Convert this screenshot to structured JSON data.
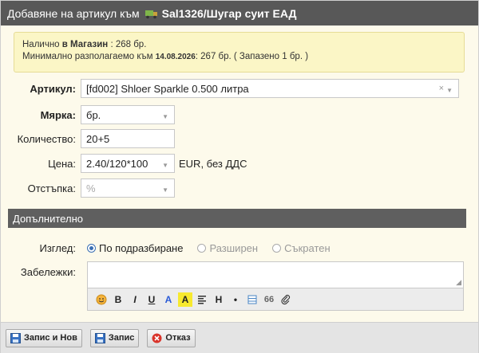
{
  "title": {
    "prefix": "Добавяне на артикул към",
    "object": "Sal1326/Шугар суит ЕАД"
  },
  "notice": {
    "line1_prefix": "Налично",
    "line1_bold": "в Магазин",
    "line1_suffix": ": 268 бр.",
    "line2_prefix": "Минимално разполагаемо към",
    "line2_date": "14.08.2026",
    "line2_suffix": ": 267 бр. ( Запазено 1 бр. )"
  },
  "form": {
    "article_label": "Артикул",
    "article_value": "[fd002] Shloer Sparkle 0.500 литра",
    "measure_label": "Мярка",
    "measure_value": "бр.",
    "quantity_label": "Количество:",
    "quantity_value": "20+5",
    "price_label": "Цена:",
    "price_value": "2.40/120*100",
    "price_unit": "EUR, без ДДС",
    "discount_label": "Отстъпка:",
    "discount_placeholder": "%"
  },
  "extra": {
    "section_title": "Допълнително",
    "view_label": "Изглед:",
    "view_options": [
      "По подразбиране",
      "Разширен",
      "Съкратен"
    ],
    "view_selected": "По подразбиране",
    "notes_label": "Забележки:",
    "toolbar_letters": {
      "bold": "B",
      "italic": "I",
      "underline": "U",
      "color": "A",
      "highlight": "A",
      "heading": "H",
      "quote": "66"
    }
  },
  "buttons": {
    "save_new": "Запис и Нов",
    "save": "Запис",
    "cancel": "Отказ"
  },
  "colors": {
    "titlebar": "#585858",
    "notice_bg": "#fbf6c6",
    "radio_active": "#3a6fb4",
    "cancel_icon": "#d9342b"
  }
}
